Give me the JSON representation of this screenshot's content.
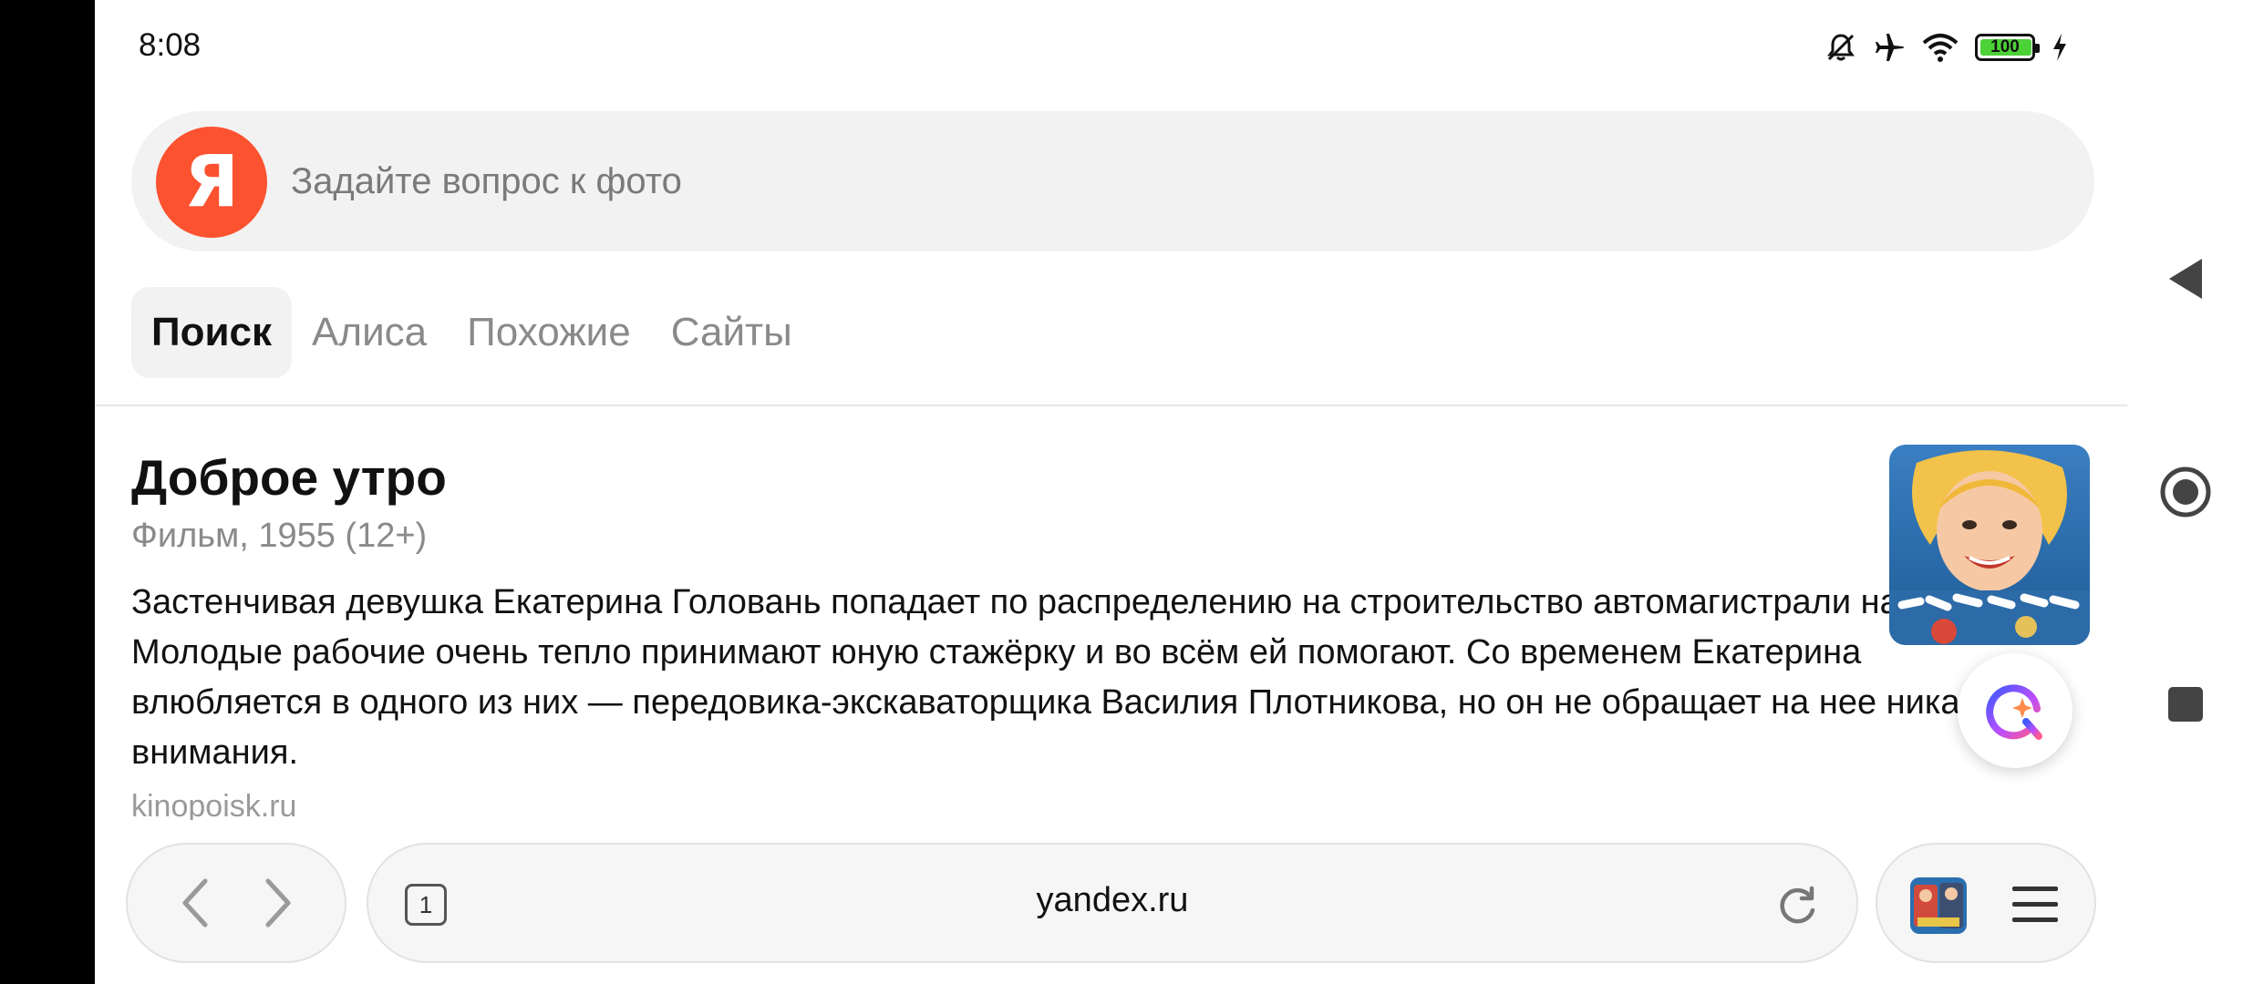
{
  "status_bar": {
    "time": "8:08",
    "battery": "100",
    "icons": [
      "mute-icon",
      "airplane-icon",
      "wifi-icon",
      "battery-icon",
      "charging-icon"
    ]
  },
  "search": {
    "logo_letter": "Я",
    "placeholder": "Задайте вопрос к фото"
  },
  "tabs": [
    {
      "label": "Поиск",
      "active": true
    },
    {
      "label": "Алиса",
      "active": false
    },
    {
      "label": "Похожие",
      "active": false
    },
    {
      "label": "Сайты",
      "active": false
    }
  ],
  "result": {
    "title": "Доброе утро",
    "meta": "Фильм, 1955 (12+)",
    "description": "Застенчивая девушка Екатерина Головань попадает по распределению на строительство автомагистрали на Кубани. Молодые рабочие очень тепло принимают юную стажёрку и во всём ей помогают. Со временем Екатерина влюбляется в одного из них — передовика-экскаваторщика Василия Плотникова, но он не обращает на нее никакого внимания.",
    "source": "kinopoisk.ru"
  },
  "toolbar": {
    "tabs_count": "1",
    "url": "yandex.ru"
  },
  "colors": {
    "brand": "#fc5230",
    "accent_gradient": [
      "#3b5bff",
      "#b84dff",
      "#ff5a8c"
    ]
  }
}
